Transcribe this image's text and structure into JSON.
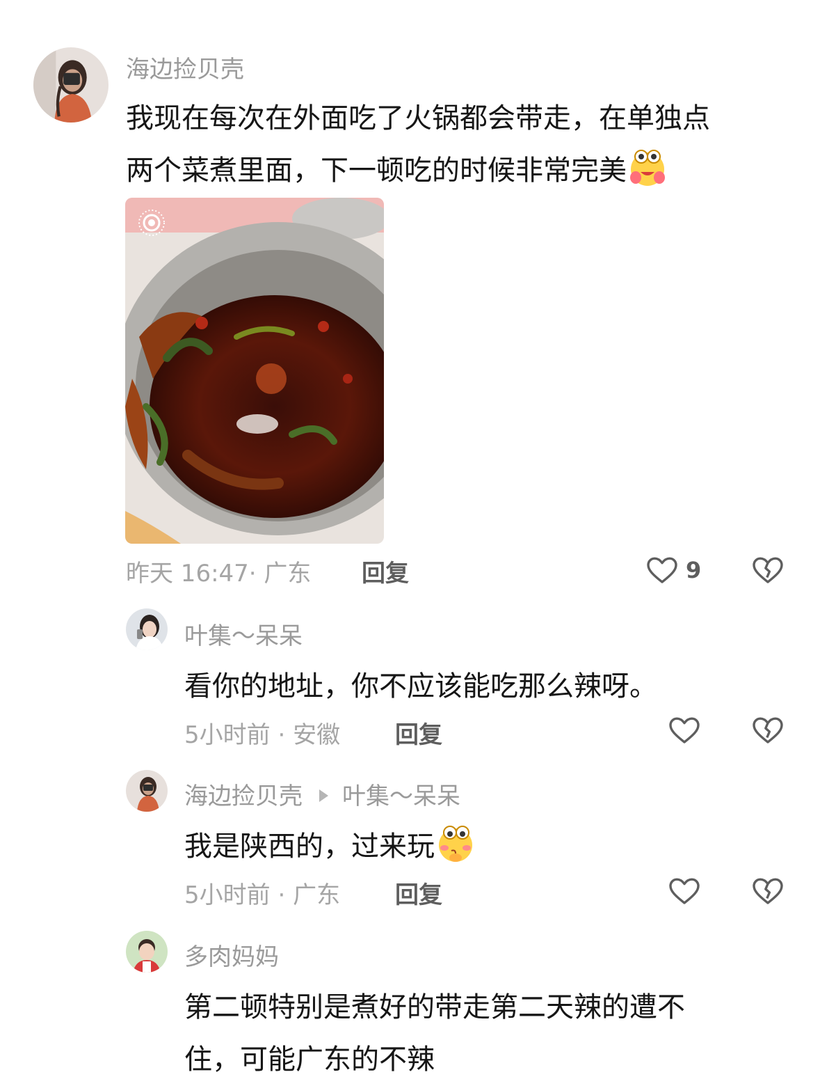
{
  "comments": [
    {
      "username": "海边捡贝壳",
      "text_lines": [
        "我现在每次在外面吃了火锅都会带走，在单独点",
        "两个菜煮里面，下一顿吃的时候非常完美"
      ],
      "emoji": "hugging-face-emoji",
      "image": "hotpot-leftover-photo",
      "time": "昨天 16:47",
      "location": "广东",
      "reply_label": "回复",
      "like_count": "9"
    },
    {
      "username": "叶集～呆呆",
      "text_lines": [
        "看你的地址，你不应该能吃那么辣呀。"
      ],
      "time": "5小时前",
      "location": "安徽",
      "reply_label": "回复"
    },
    {
      "username": "海边捡贝壳",
      "reply_to": "叶集～呆呆",
      "text_lines": [
        "我是陕西的，过来玩"
      ],
      "emoji": "thinking-blush-emoji",
      "time": "5小时前",
      "location": "广东",
      "reply_label": "回复"
    },
    {
      "username": "多肉妈妈",
      "text_lines": [
        "第二顿特别是煮好的带走第二天辣的遭不",
        "住，可能广东的不辣"
      ]
    }
  ],
  "meta_separator": "·",
  "icons": {
    "like": "heart-outline-icon",
    "dislike": "broken-heart-icon",
    "photo_badge": "live-photo-icon"
  }
}
